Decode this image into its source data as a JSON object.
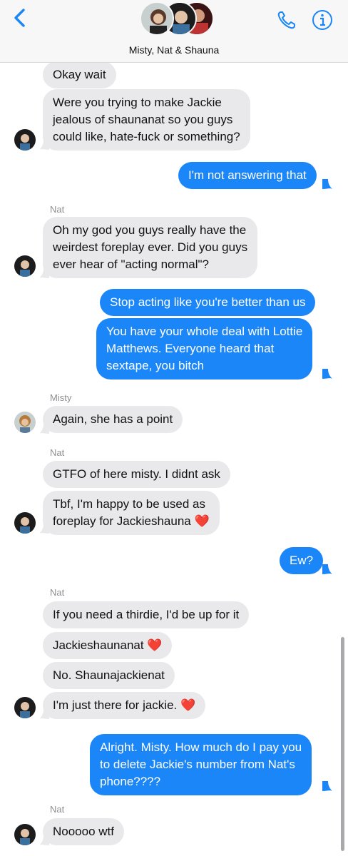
{
  "header": {
    "title": "Misty, Nat & Shauna",
    "back_icon": "chevron-left-icon",
    "phone_icon": "phone-icon",
    "info_icon": "info-icon",
    "accent": "#1b86f8"
  },
  "messages": [
    {
      "type": "in",
      "text": [
        "Okay wait"
      ]
    },
    {
      "type": "in",
      "text": [
        "Were you trying to make Jackie",
        "jealous of shaunanat so you guys",
        "could like, hate-fuck or something?"
      ]
    },
    {
      "type": "out",
      "text": [
        "I'm not answering that"
      ]
    },
    {
      "type": "sender",
      "text": "Nat"
    },
    {
      "type": "in",
      "text": [
        "Oh my god you guys really have the",
        "weirdest foreplay ever. Did you guys",
        "ever hear of \"acting normal\"?"
      ]
    },
    {
      "type": "out",
      "text": [
        "Stop acting like you're better than us"
      ]
    },
    {
      "type": "out",
      "text": [
        "You have your whole deal with Lottie",
        "Matthews. Everyone heard that",
        "sextape, you bitch"
      ]
    },
    {
      "type": "sender",
      "text": "Misty"
    },
    {
      "type": "in",
      "text": [
        "Again, she has a point"
      ]
    },
    {
      "type": "sender",
      "text": "Nat"
    },
    {
      "type": "in",
      "text": [
        "GTFO of here misty. I didnt ask"
      ]
    },
    {
      "type": "in",
      "text": [
        "Tbf, I'm happy to be used as",
        "foreplay for Jackieshauna ❤️"
      ]
    },
    {
      "type": "out",
      "text": [
        "Ew?"
      ]
    },
    {
      "type": "sender",
      "text": "Nat"
    },
    {
      "type": "in",
      "text": [
        "If you need a thirdie, I'd be up for it"
      ]
    },
    {
      "type": "in",
      "text": [
        "Jackieshaunanat ❤️"
      ]
    },
    {
      "type": "in",
      "text": [
        "No. Shaunajackienat"
      ]
    },
    {
      "type": "in",
      "text": [
        "I'm just there for jackie. ❤️"
      ]
    },
    {
      "type": "out",
      "text": [
        "Alright. Misty. How much do I pay you",
        "to delete Jackie's number from Nat's",
        "phone????"
      ]
    },
    {
      "type": "sender",
      "text": "Nat"
    },
    {
      "type": "in",
      "text": [
        "Nooooo wtf"
      ]
    }
  ]
}
